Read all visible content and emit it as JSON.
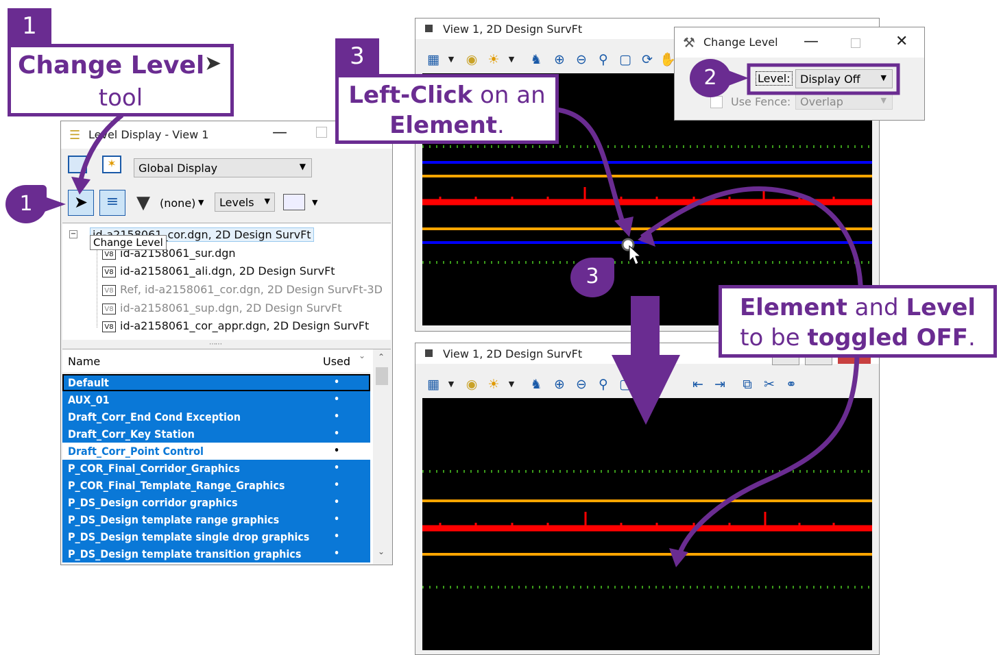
{
  "callouts": {
    "step1_badge": "1",
    "step1_title": "Change Level",
    "step1_sub": "tool",
    "step1_pointer": "1",
    "step2_pointer": "2",
    "step3_badge": "3",
    "step3_line1_bold": "Left-Click",
    "step3_line1_rest": " on an",
    "step3_line2": "Element",
    "step3_line2_end": ".",
    "step3_pointer": "3",
    "result_w1": "Element",
    "result_w2": " and ",
    "result_w3": "Level",
    "result_w4": "to be ",
    "result_w5": "toggled OFF",
    "result_w6": "."
  },
  "level_display": {
    "title": "Level Display - View 1",
    "view_select": "Global Display",
    "filter": "(none)",
    "mode_select": "Levels",
    "tooltip": "Change Level",
    "tree": [
      "id-a2158061_cor.dgn, 2D Design SurvFt",
      "id-a2158061_sur.dgn",
      "id-a2158061_ali.dgn, 2D Design SurvFt",
      "Ref, id-a2158061_cor.dgn, 2D Design SurvFt-3D",
      "id-a2158061_sup.dgn, 2D Design SurvFt",
      "id-a2158061_cor_appr.dgn, 2D Design SurvFt"
    ],
    "col_name": "Name",
    "col_used": "Used",
    "levels": [
      {
        "name": "Default",
        "selected": true
      },
      {
        "name": "AUX_01",
        "selected": true
      },
      {
        "name": "Draft_Corr_End Cond Exception",
        "selected": true
      },
      {
        "name": "Draft_Corr_Key Station",
        "selected": true
      },
      {
        "name": "Draft_Corr_Point Control",
        "selected": false
      },
      {
        "name": "P_COR_Final_Corridor_Graphics",
        "selected": true
      },
      {
        "name": "P_COR_Final_Template_Range_Graphics",
        "selected": true
      },
      {
        "name": "P_DS_Design corridor graphics",
        "selected": true
      },
      {
        "name": "P_DS_Design template range graphics",
        "selected": true
      },
      {
        "name": "P_DS_Design template single drop graphics",
        "selected": true
      },
      {
        "name": "P_DS_Design template transition graphics",
        "selected": true
      }
    ],
    "used_mark": "•"
  },
  "view_top": {
    "title": "View 1, 2D Design SurvFt"
  },
  "view_bottom": {
    "title": "View 1, 2D Design SurvFt"
  },
  "change_level": {
    "title": "Change Level",
    "level_label": "Level:",
    "level_value": "Display Off",
    "fence_label": "Use Fence:",
    "fence_value": "Overlap"
  },
  "colors": {
    "purple": "#6a2c91",
    "selection": "#0a78d7",
    "red_line": "#ff0000",
    "orange_line": "#ffa500",
    "blue_line": "#0000ff",
    "green_dots": "#3a9a1a"
  }
}
